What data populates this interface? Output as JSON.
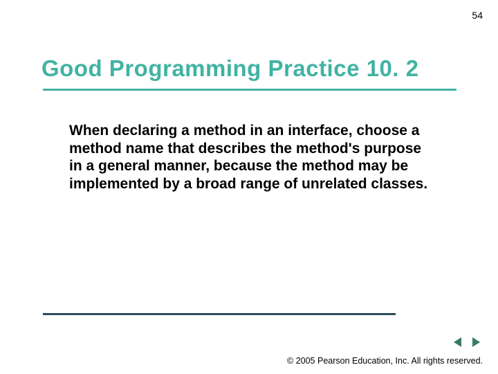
{
  "page_number": "54",
  "title": "Good Programming Practice 10. 2",
  "body": "When declaring a method in an interface, choose a method name that describes the method's purpose in a general manner, because the method may be implemented by a broad range of unrelated classes.",
  "copyright": "© 2005 Pearson Education, Inc. All rights reserved.",
  "colors": {
    "accent": "#41b3a3",
    "nav_arrow": "#3a7a6a",
    "footer_rule": "#2a4a5a"
  }
}
